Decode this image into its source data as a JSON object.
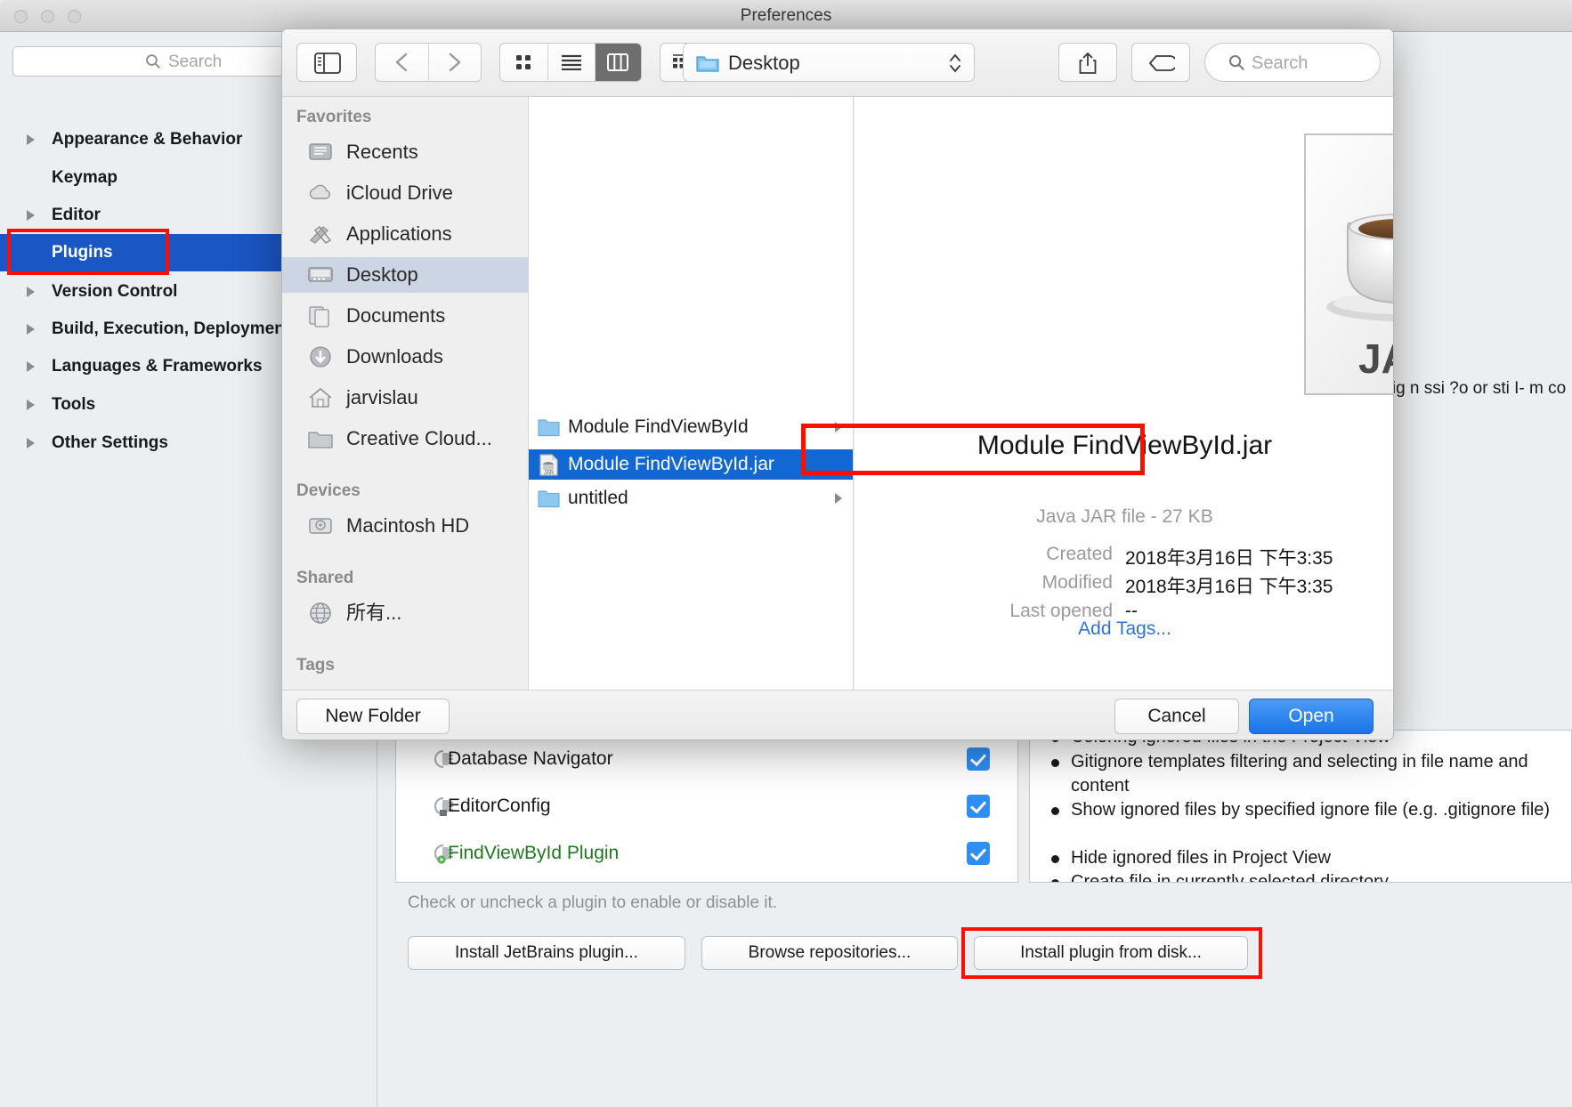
{
  "prefs_window": {
    "title": "Preferences",
    "search": {
      "placeholder": "Search",
      "icon": "search-icon"
    },
    "nav_items": [
      {
        "label": "Appearance & Behavior",
        "expandable": true,
        "selected": false
      },
      {
        "label": "Keymap",
        "expandable": false,
        "selected": false
      },
      {
        "label": "Editor",
        "expandable": true,
        "selected": false
      },
      {
        "label": "Plugins",
        "expandable": false,
        "selected": true
      },
      {
        "label": "Version Control",
        "expandable": true,
        "selected": false
      },
      {
        "label": "Build, Execution, Deployment",
        "expandable": true,
        "selected": false
      },
      {
        "label": "Languages & Frameworks",
        "expandable": true,
        "selected": false
      },
      {
        "label": "Tools",
        "expandable": true,
        "selected": false
      },
      {
        "label": "Other Settings",
        "expandable": true,
        "selected": false
      }
    ],
    "plugins": [
      {
        "name": "Database Navigator",
        "checked": true,
        "highlighted": false
      },
      {
        "name": "EditorConfig",
        "checked": true,
        "highlighted": false
      },
      {
        "name": "FindViewById Plugin",
        "checked": true,
        "highlighted": true
      }
    ],
    "plugin_hint": "Check or uncheck a plugin to enable or disable it.",
    "buttons": {
      "install_jetbrains": "Install JetBrains plugin...",
      "browse_repositories": "Browse repositories...",
      "install_from_disk": "Install plugin from disk..."
    },
    "description_items": [
      "Coloring ignored files in the Project View",
      "Gitignore templates filtering and selecting in file name and content",
      "Show ignored files by specified ignore file (e.g. .gitignore file)",
      "Hide ignored files in Project View",
      "Create file in currently selected directory"
    ],
    "side_text": "a ig n ssi ?o or sti I- m co"
  },
  "file_dialog": {
    "toolbar": {
      "sidebar_toggle_icon": "sidebar-toggle-icon",
      "back_icon": "chevron-left-icon",
      "forward_icon": "chevron-right-icon",
      "view_icon_grid": "icon-view-icon",
      "view_list": "list-view-icon",
      "view_column": "column-view-icon",
      "active_view": "column",
      "group_icon": "group-by-icon",
      "path_label": "Desktop",
      "path_icon": "folder-icon",
      "share_icon": "share-icon",
      "tag_icon": "tag-icon",
      "search_placeholder": "Search",
      "search_icon": "search-icon"
    },
    "sidebar": {
      "groups": [
        {
          "title": "Favorites",
          "items": [
            {
              "label": "Recents",
              "icon": "recents-icon",
              "selected": false
            },
            {
              "label": "iCloud Drive",
              "icon": "icloud-icon",
              "selected": false
            },
            {
              "label": "Applications",
              "icon": "applications-icon",
              "selected": false
            },
            {
              "label": "Desktop",
              "icon": "desktop-icon",
              "selected": true
            },
            {
              "label": "Documents",
              "icon": "documents-icon",
              "selected": false
            },
            {
              "label": "Downloads",
              "icon": "downloads-icon",
              "selected": false
            },
            {
              "label": "jarvislau",
              "icon": "home-icon",
              "selected": false
            },
            {
              "label": "Creative Cloud...",
              "icon": "folder-icon",
              "selected": false
            }
          ]
        },
        {
          "title": "Devices",
          "items": [
            {
              "label": "Macintosh HD",
              "icon": "harddisk-icon",
              "selected": false
            }
          ]
        },
        {
          "title": "Shared",
          "items": [
            {
              "label": "所有...",
              "icon": "network-icon",
              "selected": false
            }
          ]
        },
        {
          "title": "Tags",
          "items": []
        }
      ]
    },
    "file_list": [
      {
        "name": "Module FindViewById",
        "icon": "folder-icon",
        "selected": false,
        "has_children": true
      },
      {
        "name": "Module FindViewById.jar",
        "icon": "jar-icon",
        "selected": true,
        "has_children": false
      },
      {
        "name": "untitled",
        "icon": "folder-icon",
        "selected": false,
        "has_children": true
      }
    ],
    "preview": {
      "icon": "jar-file-icon",
      "icon_label": "JAR",
      "title": "Module FindViewById.jar",
      "kind": "Java JAR file - 27 KB",
      "meta": [
        {
          "label": "Created",
          "value": "2018年3月16日 下午3:35"
        },
        {
          "label": "Modified",
          "value": "2018年3月16日 下午3:35"
        },
        {
          "label": "Last opened",
          "value": "--"
        }
      ],
      "add_tags": "Add Tags..."
    },
    "footer": {
      "new_folder": "New Folder",
      "cancel": "Cancel",
      "open": "Open"
    }
  },
  "colors": {
    "annotation_red": "#fa0f00",
    "selection_blue": "#1267d2",
    "nav_selection_blue": "#1a56c4",
    "open_button_blue": "#1a73e8",
    "checkbox_blue": "#2f8ef4",
    "plugin_green": "#1f7a1f",
    "link_blue": "#2d74d6"
  }
}
